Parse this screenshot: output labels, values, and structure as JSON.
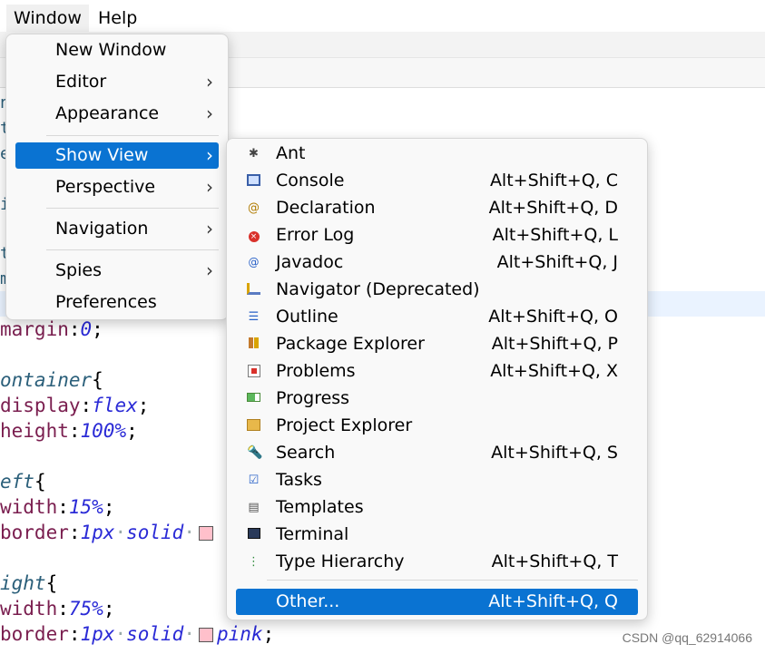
{
  "menubar": {
    "items": [
      {
        "label": "Window"
      },
      {
        "label": "Help"
      }
    ]
  },
  "window_menu": {
    "items": [
      {
        "label": "New Window"
      },
      {
        "label": "Editor",
        "submenu_arrow": "›"
      },
      {
        "label": "Appearance",
        "submenu_arrow": "›"
      },
      {
        "label": "Show View",
        "submenu_arrow": "›"
      },
      {
        "label": "Perspective",
        "submenu_arrow": "›"
      },
      {
        "label": "Navigation",
        "submenu_arrow": "›"
      },
      {
        "label": "Spies",
        "submenu_arrow": "›"
      },
      {
        "label": "Preferences"
      }
    ]
  },
  "show_view_menu": {
    "items": [
      {
        "label": "Ant",
        "shortcut": "",
        "icon": "ant-icon"
      },
      {
        "label": "Console",
        "shortcut": "Alt+Shift+Q, C",
        "icon": "console-icon"
      },
      {
        "label": "Declaration",
        "shortcut": "Alt+Shift+Q, D",
        "icon": "declaration-icon"
      },
      {
        "label": "Error Log",
        "shortcut": "Alt+Shift+Q, L",
        "icon": "error-log-icon"
      },
      {
        "label": "Javadoc",
        "shortcut": "Alt+Shift+Q, J",
        "icon": "javadoc-icon"
      },
      {
        "label": "Navigator (Deprecated)",
        "shortcut": "",
        "icon": "navigator-icon"
      },
      {
        "label": "Outline",
        "shortcut": "Alt+Shift+Q, O",
        "icon": "outline-icon"
      },
      {
        "label": "Package Explorer",
        "shortcut": "Alt+Shift+Q, P",
        "icon": "package-explorer-icon"
      },
      {
        "label": "Problems",
        "shortcut": "Alt+Shift+Q, X",
        "icon": "problems-icon"
      },
      {
        "label": "Progress",
        "shortcut": "",
        "icon": "progress-icon"
      },
      {
        "label": "Project Explorer",
        "shortcut": "",
        "icon": "project-explorer-icon"
      },
      {
        "label": "Search",
        "shortcut": "Alt+Shift+Q, S",
        "icon": "search-icon"
      },
      {
        "label": "Tasks",
        "shortcut": "",
        "icon": "tasks-icon"
      },
      {
        "label": "Templates",
        "shortcut": "",
        "icon": "templates-icon"
      },
      {
        "label": "Terminal",
        "shortcut": "",
        "icon": "terminal-icon"
      },
      {
        "label": "Type Hierarchy",
        "shortcut": "Alt+Shift+Q, T",
        "icon": "type-hierarchy-icon"
      },
      {
        "label": "Other...",
        "shortcut": "Alt+Shift+Q, Q",
        "icon": ""
      }
    ]
  },
  "editor": {
    "margin_chars": [
      "n",
      "t",
      "e",
      "i",
      "t",
      "m"
    ],
    "lines": [
      {
        "prop": "margin",
        "value": "0"
      },
      {
        "selector": "ontainer"
      },
      {
        "prop": "display",
        "value": "flex"
      },
      {
        "prop": "height",
        "value": "100%"
      },
      {
        "selector": "eft"
      },
      {
        "prop": "width",
        "value": "15%"
      },
      {
        "prop": "border",
        "value1": "1px",
        "value2": "solid"
      },
      {
        "selector": "ight"
      },
      {
        "prop": "width",
        "value": "75%"
      },
      {
        "prop": "border",
        "value1": "1px",
        "value2": "solid",
        "value3": "pink"
      }
    ],
    "colors": {
      "swatch": "#ffc0cb",
      "selector": "#2b5f7a",
      "property": "#7a1e4f",
      "value": "#2a2ad6"
    }
  },
  "watermark": "CSDN @qq_62914066",
  "colors": {
    "selection": "#0a73d2",
    "menu_bg": "#f9f9f9"
  }
}
